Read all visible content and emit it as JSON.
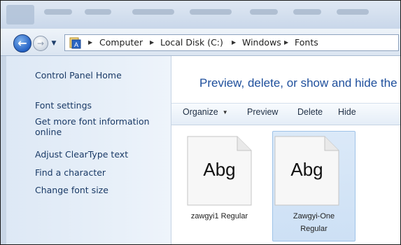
{
  "address": {
    "crumbs": [
      "Computer",
      "Local Disk (C:)",
      "Windows",
      "Fonts"
    ]
  },
  "left_pane": {
    "home": "Control Panel Home",
    "tasks": [
      "Font settings",
      "Get more font information online",
      "Adjust ClearType text",
      "Find a character",
      "Change font size"
    ]
  },
  "main": {
    "title": "Preview, delete, or show and hide the"
  },
  "toolbar": {
    "organize": "Organize",
    "preview": "Preview",
    "delete": "Delete",
    "hide": "Hide"
  },
  "fonts": [
    {
      "sample": "Abg",
      "name": "zawgyi1 Regular",
      "selected": false
    },
    {
      "sample": "Abg",
      "name": "Zawgyi-One Regular",
      "selected": true
    }
  ],
  "colors": {
    "title_blue": "#1e4f9c",
    "task_blue": "#1a3a66",
    "selection": "#cde0f5"
  }
}
